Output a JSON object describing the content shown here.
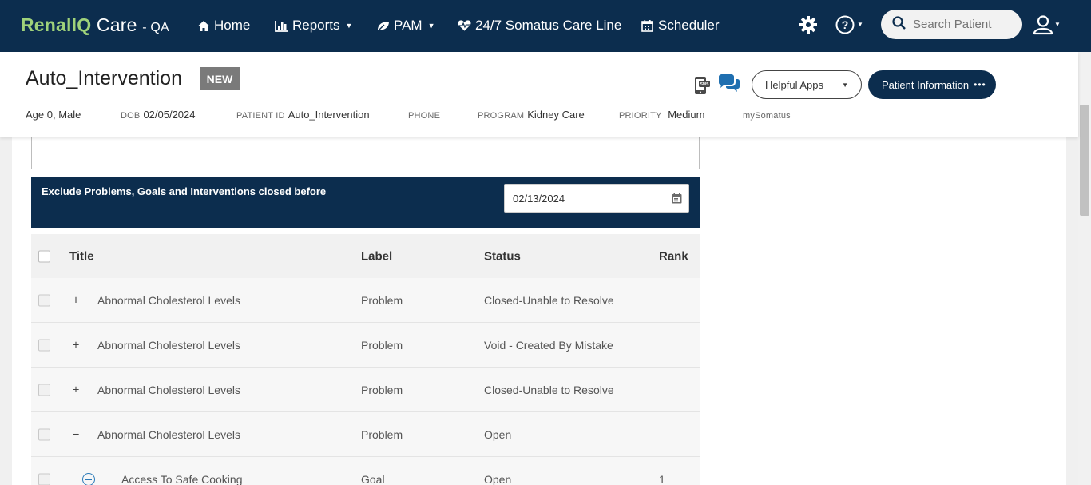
{
  "brand": {
    "part1": "RenalIQ",
    "part2": " Care",
    "part3": " - QA"
  },
  "nav": {
    "home": "Home",
    "reports": "Reports",
    "pam": "PAM",
    "careline": "24/7 Somatus Care Line",
    "scheduler": "Scheduler"
  },
  "search": {
    "placeholder": "Search Patient"
  },
  "patient": {
    "name": "Auto_Intervention",
    "badge": "NEW",
    "age_sex": "Age 0, Male",
    "dob_label": "DOB",
    "dob": "02/05/2024",
    "id_label": "PATIENT ID",
    "id": "Auto_Intervention",
    "phone_label": "PHONE",
    "program_label": "PROGRAM",
    "program": "Kidney Care",
    "priority_label": "PRIORITY",
    "priority": "Medium",
    "mysomatus": "mySomatus"
  },
  "actions": {
    "helpful_apps": "Helpful Apps",
    "patient_info": "Patient Information",
    "patient_info_dots": "•••"
  },
  "filter": {
    "label": "Exclude Problems, Goals and Interventions closed before",
    "date": "02/13/2024"
  },
  "table": {
    "headers": {
      "title": "Title",
      "label": "Label",
      "status": "Status",
      "rank": "Rank"
    },
    "rows": [
      {
        "expander": "+",
        "title": "Abnormal Cholesterol Levels",
        "label": "Problem",
        "status": "Closed-Unable to Resolve",
        "rank": ""
      },
      {
        "expander": "+",
        "title": "Abnormal Cholesterol Levels",
        "label": "Problem",
        "status": "Void - Created By Mistake",
        "rank": ""
      },
      {
        "expander": "+",
        "title": "Abnormal Cholesterol Levels",
        "label": "Problem",
        "status": "Closed-Unable to Resolve",
        "rank": ""
      },
      {
        "expander": "−",
        "title": "Abnormal Cholesterol Levels",
        "label": "Problem",
        "status": "Open",
        "rank": ""
      },
      {
        "expander": "",
        "title": "Access To Safe Cooking",
        "label": "Goal",
        "status": "Open",
        "rank": "1"
      }
    ]
  },
  "colors": {
    "navy": "#0c2d4e",
    "brand_green": "#9fd27a",
    "badge_gray": "#7a7a7a"
  }
}
